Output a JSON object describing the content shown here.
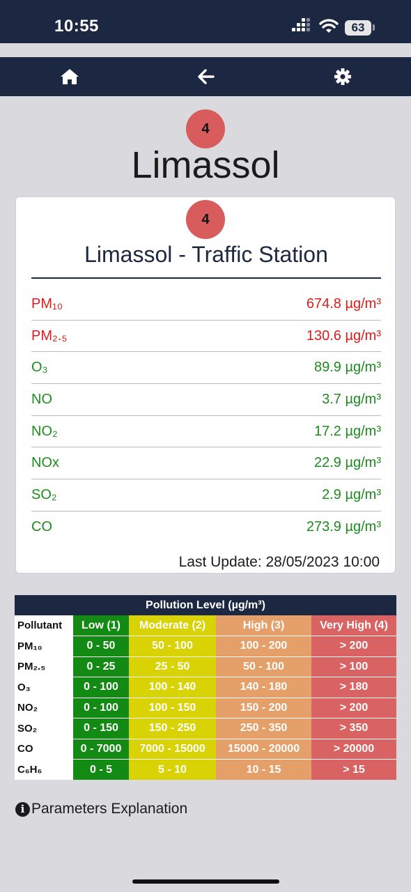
{
  "status_bar": {
    "time": "10:55",
    "battery": "63"
  },
  "nav": {
    "icons": [
      "home-icon",
      "back-arrow-icon",
      "gear-icon"
    ]
  },
  "city": {
    "name": "Limassol",
    "aqi_level": "4"
  },
  "station": {
    "name": "Limassol - Traffic Station",
    "aqi_level": "4",
    "measurements": [
      {
        "pollutant": "PM₁₀",
        "value": "674.8 µg/m³",
        "status": "red"
      },
      {
        "pollutant": "PM₂.₅",
        "value": "130.6 µg/m³",
        "status": "red"
      },
      {
        "pollutant": "O₃",
        "value": "89.9 µg/m³",
        "status": "green"
      },
      {
        "pollutant": "NO",
        "value": "3.7 µg/m³",
        "status": "green"
      },
      {
        "pollutant": "NO₂",
        "value": "17.2 µg/m³",
        "status": "green"
      },
      {
        "pollutant": "NOx",
        "value": "22.9 µg/m³",
        "status": "green"
      },
      {
        "pollutant": "SO₂",
        "value": "2.9 µg/m³",
        "status": "green"
      },
      {
        "pollutant": "CO",
        "value": "273.9 µg/m³",
        "status": "green"
      }
    ],
    "last_update": "Last Update: 28/05/2023 10:00"
  },
  "levels_table": {
    "caption": "Pollution Level (µg/m³)",
    "headers": [
      "Pollutant",
      "Low (1)",
      "Moderate (2)",
      "High (3)",
      "Very High (4)"
    ],
    "rows": [
      {
        "pollutant": "PM₁₀",
        "low": "0 - 50",
        "moderate": "50 - 100",
        "high": "100 - 200",
        "very_high": "> 200"
      },
      {
        "pollutant": "PM₂.₅",
        "low": "0 - 25",
        "moderate": "25 - 50",
        "high": "50 - 100",
        "very_high": "> 100"
      },
      {
        "pollutant": "O₃",
        "low": "0 - 100",
        "moderate": "100 - 140",
        "high": "140 - 180",
        "very_high": "> 180"
      },
      {
        "pollutant": "NO₂",
        "low": "0 - 100",
        "moderate": "100 - 150",
        "high": "150 - 200",
        "very_high": "> 200"
      },
      {
        "pollutant": "SO₂",
        "low": "0 - 150",
        "moderate": "150 - 250",
        "high": "250 - 350",
        "very_high": "> 350"
      },
      {
        "pollutant": "CO",
        "low": "0 - 7000",
        "moderate": "7000 - 15000",
        "high": "15000 - 20000",
        "very_high": "> 20000"
      },
      {
        "pollutant": "C₆H₆",
        "low": "0 - 5",
        "moderate": "5 - 10",
        "high": "10 - 15",
        "very_high": "> 15"
      }
    ],
    "colors": {
      "low": "#138a13",
      "moderate": "#d9d306",
      "high": "#e5a06a",
      "very_high": "#d96262"
    }
  },
  "footer": {
    "params_link": "Parameters Explanation"
  }
}
